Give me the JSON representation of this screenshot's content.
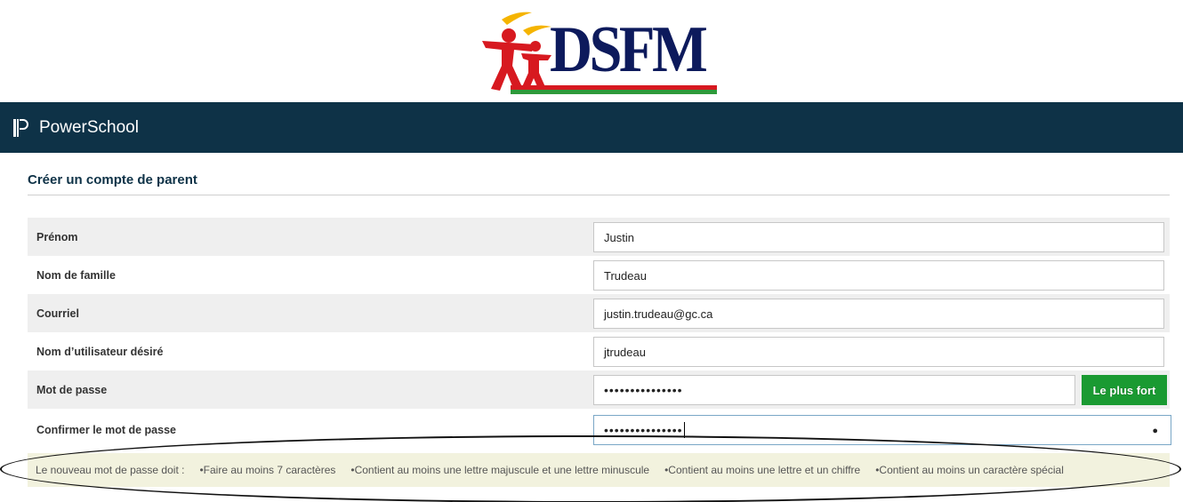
{
  "logo": {
    "text": "DSFM"
  },
  "header": {
    "app_name": "PowerSchool"
  },
  "page": {
    "title": "Créer un compte de parent"
  },
  "form": {
    "first_name": {
      "label": "Prénom",
      "value": "Justin"
    },
    "last_name": {
      "label": "Nom de famille",
      "value": "Trudeau"
    },
    "email": {
      "label": "Courriel",
      "value": "justin.trudeau@gc.ca"
    },
    "username": {
      "label": "Nom d’utilisateur désiré",
      "value": "jtrudeau"
    },
    "password": {
      "label": "Mot de passe",
      "value": "•••••••••••••••",
      "strength": "Le plus fort"
    },
    "confirm_password": {
      "label": "Confirmer le mot de passe",
      "value": "•••••••••••••••"
    }
  },
  "requirements": {
    "intro": "Le nouveau mot de passe doit :",
    "items": [
      "•Faire au moins 7 caractères",
      "•Contient au moins une lettre majuscule et une lettre minuscule",
      "•Contient au moins une lettre et un chiffre",
      "•Contient au moins un caractère spécial"
    ]
  },
  "colors": {
    "header_bg": "#0e3247",
    "strength_green": "#1a9a32",
    "requirements_bg": "#f2f2de",
    "logo_navy": "#0d1a5c",
    "logo_red": "#d71920",
    "logo_yellow": "#f5b400"
  },
  "icons": [
    "dsfm-logo-figures",
    "powerschool-p-icon",
    "eye-icon"
  ]
}
